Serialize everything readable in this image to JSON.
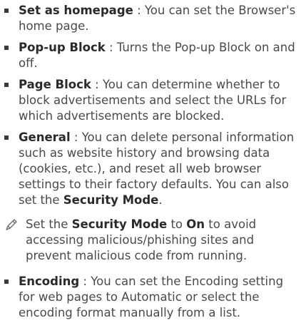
{
  "items": [
    {
      "term": "Set as homepage",
      "sep": " : ",
      "desc": "You can set the Browser's home page."
    },
    {
      "term": "Pop-up Block",
      "sep": " : ",
      "desc": "Turns the Pop-up Block on and off."
    },
    {
      "term": "Page Block",
      "sep": " : ",
      "desc": "You can determine whether to block advertisements and select the URLs for which advertisements are blocked."
    },
    {
      "term": "General",
      "sep": " : ",
      "desc": "You can delete personal information such as website history and browsing data (cookies, etc.), and reset all web browser settings to their factory defaults. You can also set the ",
      "strong": "Security Mode",
      "end": "."
    }
  ],
  "note": {
    "icon": "pencil-note-icon",
    "text1": "Set the ",
    "strong1": "Security Mode",
    "text2": " to ",
    "strong2": "On",
    "text3": " to avoid accessing malicious/phishing sites and prevent malicious code from running."
  },
  "last_item": {
    "term": "Encoding",
    "sep": " : ",
    "desc": "You can set the Encoding setting for web pages to Automatic or select the encoding format manually from a list."
  }
}
